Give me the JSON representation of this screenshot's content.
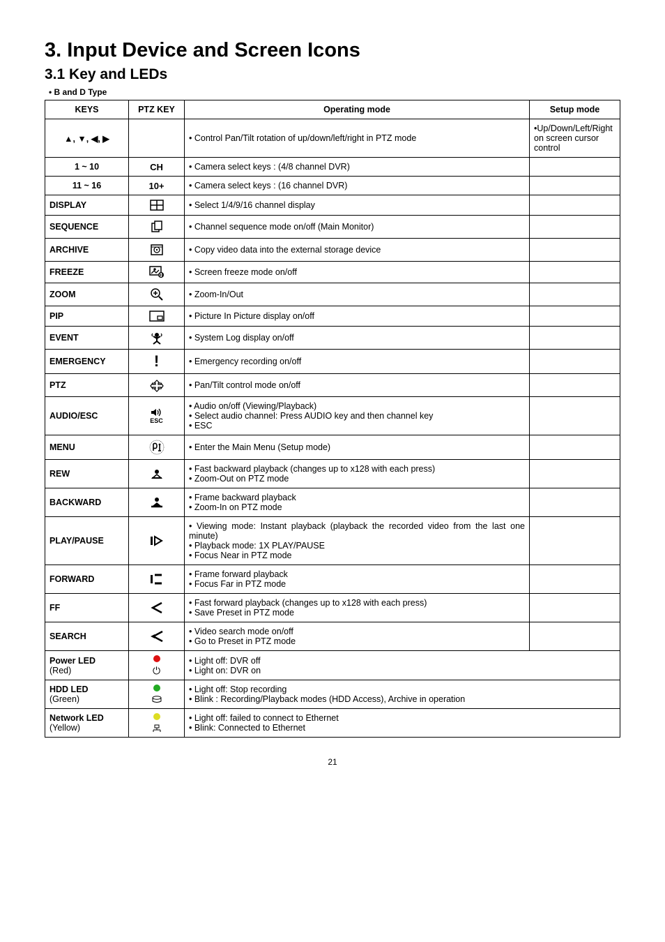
{
  "chapter_title": "3.  Input Device and Screen Icons",
  "section_title": "3.1  Key and LEDs",
  "type_note": "• B and D Type",
  "headers": {
    "keys": "KEYS",
    "ptz": "PTZ KEY",
    "op": "Operating mode",
    "setup": "Setup mode"
  },
  "rows": {
    "arrows": {
      "key": "▲, ▼, ◀, ▶",
      "op": "• Control Pan/Tilt rotation of up/down/left/right in PTZ mode",
      "setup": "•Up/Down/Left/Right on screen cursor control"
    },
    "ch": {
      "key": "1 ~ 10",
      "ptz": "CH",
      "op": "• Camera select keys : (4/8 channel DVR)"
    },
    "ch16": {
      "key": "11 ~ 16",
      "ptz": "10+",
      "op": "• Camera select keys : (16 channel DVR)"
    },
    "display": {
      "key": "DISPLAY",
      "op": "• Select 1/4/9/16 channel display"
    },
    "sequence": {
      "key": "SEQUENCE",
      "op": "• Channel sequence mode on/off (Main Monitor)"
    },
    "archive": {
      "key": "ARCHIVE",
      "op": "• Copy video data into the external storage device"
    },
    "freeze": {
      "key": "FREEZE",
      "op": "• Screen freeze mode on/off"
    },
    "zoom": {
      "key": "ZOOM",
      "op": "• Zoom-In/Out"
    },
    "pip": {
      "key": "PIP",
      "op": "• Picture In Picture display on/off"
    },
    "event": {
      "key": "EVENT",
      "op": "• System Log display on/off"
    },
    "emergency": {
      "key": "EMERGENCY",
      "op": "• Emergency recording on/off"
    },
    "ptz": {
      "key": "PTZ",
      "op": "• Pan/Tilt control mode on/off"
    },
    "audio": {
      "key": "AUDIO/ESC",
      "esc_label": "ESC",
      "op": "• Audio on/off (Viewing/Playback)\n• Select audio channel: Press AUDIO key and then channel key\n• ESC"
    },
    "menu": {
      "key": "MENU",
      "op": "• Enter the Main Menu (Setup mode)"
    },
    "rew": {
      "key": "REW",
      "op": "• Fast backward playback (changes up to x128 with each press)\n• Zoom-Out on PTZ mode"
    },
    "backward": {
      "key": "BACKWARD",
      "op": "• Frame backward playback\n• Zoom-In on PTZ mode"
    },
    "play": {
      "key": "PLAY/PAUSE",
      "op": "•  Viewing  mode:  Instant  playback  (playback  the  recorded  video from the last one minute)\n• Playback mode: 1X PLAY/PAUSE\n• Focus Near in PTZ mode"
    },
    "forward": {
      "key": "FORWARD",
      "op": "• Frame forward playback\n• Focus Far in PTZ mode"
    },
    "ff": {
      "key": "FF",
      "op": "• Fast forward playback (changes up to x128 with each press)\n• Save Preset in PTZ mode"
    },
    "search": {
      "key": "SEARCH",
      "op": "• Video search mode on/off\n• Go to Preset in PTZ mode"
    },
    "power": {
      "key": "Power LED\n(Red)",
      "op": "• Light off: DVR off\n• Light on: DVR on"
    },
    "hdd": {
      "key": "HDD LED\n(Green)",
      "op": "• Light off: Stop recording\n• Blink : Recording/Playback modes (HDD Access), Archive in operation"
    },
    "net": {
      "key": "Network LED\n(Yellow)",
      "op": "• Light off: failed to connect to Ethernet\n• Blink: Connected to Ethernet"
    }
  },
  "page_number": "21"
}
